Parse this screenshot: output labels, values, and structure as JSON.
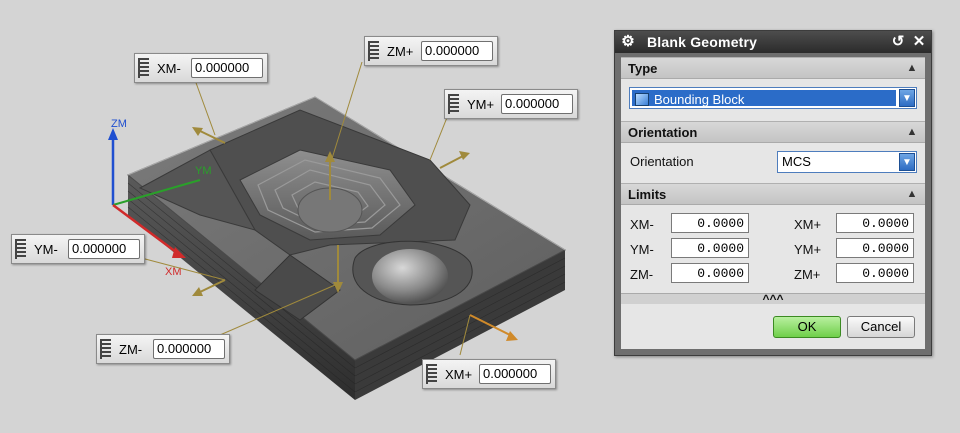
{
  "view": {
    "axis_labels": {
      "zm": "ZM",
      "ym": "YM",
      "xm": "XM"
    },
    "handles": [
      {
        "id": "xm-minus",
        "label": "XM-",
        "value": "0.000000"
      },
      {
        "id": "zm-plus",
        "label": "ZM+",
        "value": "0.000000"
      },
      {
        "id": "ym-plus",
        "label": "YM+",
        "value": "0.000000"
      },
      {
        "id": "ym-minus",
        "label": "YM-",
        "value": "0.000000"
      },
      {
        "id": "zm-minus",
        "label": "ZM-",
        "value": "0.000000"
      },
      {
        "id": "xm-plus",
        "label": "XM+",
        "value": "0.000000"
      }
    ]
  },
  "dialog": {
    "title": "Blank Geometry",
    "type_section": {
      "title": "Type",
      "selected": "Bounding Block"
    },
    "orientation_section": {
      "title": "Orientation",
      "field_label": "Orientation",
      "selected": "MCS"
    },
    "limits_section": {
      "title": "Limits",
      "fields": [
        {
          "label": "XM-",
          "value": "0.0000"
        },
        {
          "label": "XM+",
          "value": "0.0000"
        },
        {
          "label": "YM-",
          "value": "0.0000"
        },
        {
          "label": "YM+",
          "value": "0.0000"
        },
        {
          "label": "ZM-",
          "value": "0.0000"
        },
        {
          "label": "ZM+",
          "value": "0.0000"
        }
      ]
    },
    "more_label": "^^^",
    "ok_label": "OK",
    "cancel_label": "Cancel"
  },
  "colors": {
    "background": "#d4d4d4",
    "part_gray": "#6a6a6a",
    "handle_line": "#a08a3c",
    "axis_z": "#1f4fd0",
    "axis_y": "#2aa02a",
    "axis_x": "#d02a2a",
    "ok_green": "#6fcf4a",
    "title_bar": "#2b2b2b"
  }
}
